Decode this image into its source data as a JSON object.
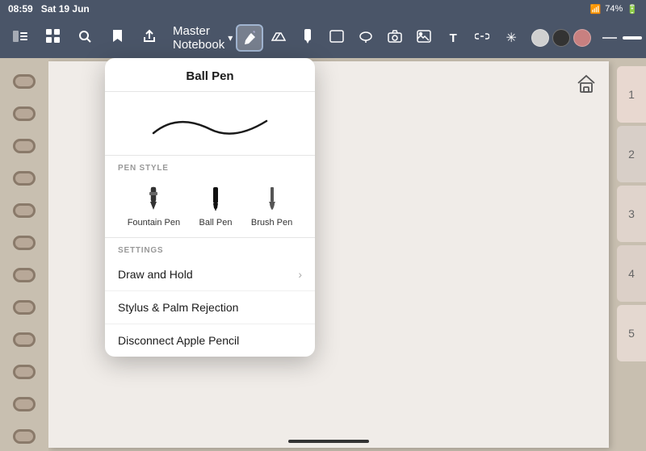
{
  "statusBar": {
    "time": "08:59",
    "date": "Sat 19 Jun",
    "battery": "74%",
    "batteryIcon": "🔋"
  },
  "toolbar": {
    "notebookTitle": "Master Notebook",
    "chevronDown": "▾",
    "tools": [
      {
        "name": "sidebar-toggle",
        "icon": "⊞",
        "active": false
      },
      {
        "name": "grid-view",
        "icon": "⊟",
        "active": false
      },
      {
        "name": "search",
        "icon": "🔍",
        "active": false
      },
      {
        "name": "bookmark",
        "icon": "🔖",
        "active": false
      },
      {
        "name": "share",
        "icon": "↑",
        "active": false
      }
    ],
    "drawTools": [
      {
        "name": "pen",
        "icon": "✏",
        "active": true
      },
      {
        "name": "eraser",
        "icon": "⬜",
        "active": false
      },
      {
        "name": "marker",
        "icon": "🖊",
        "active": false
      },
      {
        "name": "select",
        "icon": "◻",
        "active": false
      },
      {
        "name": "lasso",
        "icon": "○",
        "active": false
      },
      {
        "name": "camera",
        "icon": "◎",
        "active": false
      },
      {
        "name": "image",
        "icon": "🖼",
        "active": false
      },
      {
        "name": "text",
        "icon": "T",
        "active": false
      },
      {
        "name": "link",
        "icon": "⬡",
        "active": false
      },
      {
        "name": "wand",
        "icon": "✳",
        "active": false
      }
    ],
    "colors": [
      {
        "name": "color-light-gray",
        "hex": "#d0d0d0"
      },
      {
        "name": "color-dark",
        "hex": "#333333"
      },
      {
        "name": "color-pink",
        "hex": "#c88080"
      }
    ],
    "strokes": [
      {
        "name": "thin-stroke",
        "label": "—"
      },
      {
        "name": "medium-stroke",
        "label": "━"
      },
      {
        "name": "thick-stroke",
        "label": "▬"
      }
    ],
    "rightTools": [
      {
        "name": "undo",
        "icon": "↩"
      },
      {
        "name": "redo",
        "icon": "↪"
      },
      {
        "name": "export",
        "icon": "⬆"
      },
      {
        "name": "close",
        "icon": "✕"
      },
      {
        "name": "more",
        "icon": "•••"
      }
    ]
  },
  "dropdown": {
    "title": "Ball Pen",
    "penStyleSection": "Pen Style",
    "penStyles": [
      {
        "name": "fountain-pen",
        "label": "Fountain Pen",
        "selected": false
      },
      {
        "name": "ball-pen",
        "label": "Ball Pen",
        "selected": true
      },
      {
        "name": "brush-pen",
        "label": "Brush Pen",
        "selected": false
      }
    ],
    "settingsSection": "Settings",
    "settings": [
      {
        "name": "draw-and-hold",
        "label": "Draw and Hold",
        "hasChevron": true
      },
      {
        "name": "stylus-palm-rejection",
        "label": "Stylus & Palm Rejection",
        "hasChevron": false
      },
      {
        "name": "disconnect-apple-pencil",
        "label": "Disconnect Apple Pencil",
        "hasChevron": false
      }
    ]
  },
  "tabs": [
    {
      "label": "1"
    },
    {
      "label": "2"
    },
    {
      "label": "3"
    },
    {
      "label": "4"
    },
    {
      "label": "5"
    }
  ]
}
